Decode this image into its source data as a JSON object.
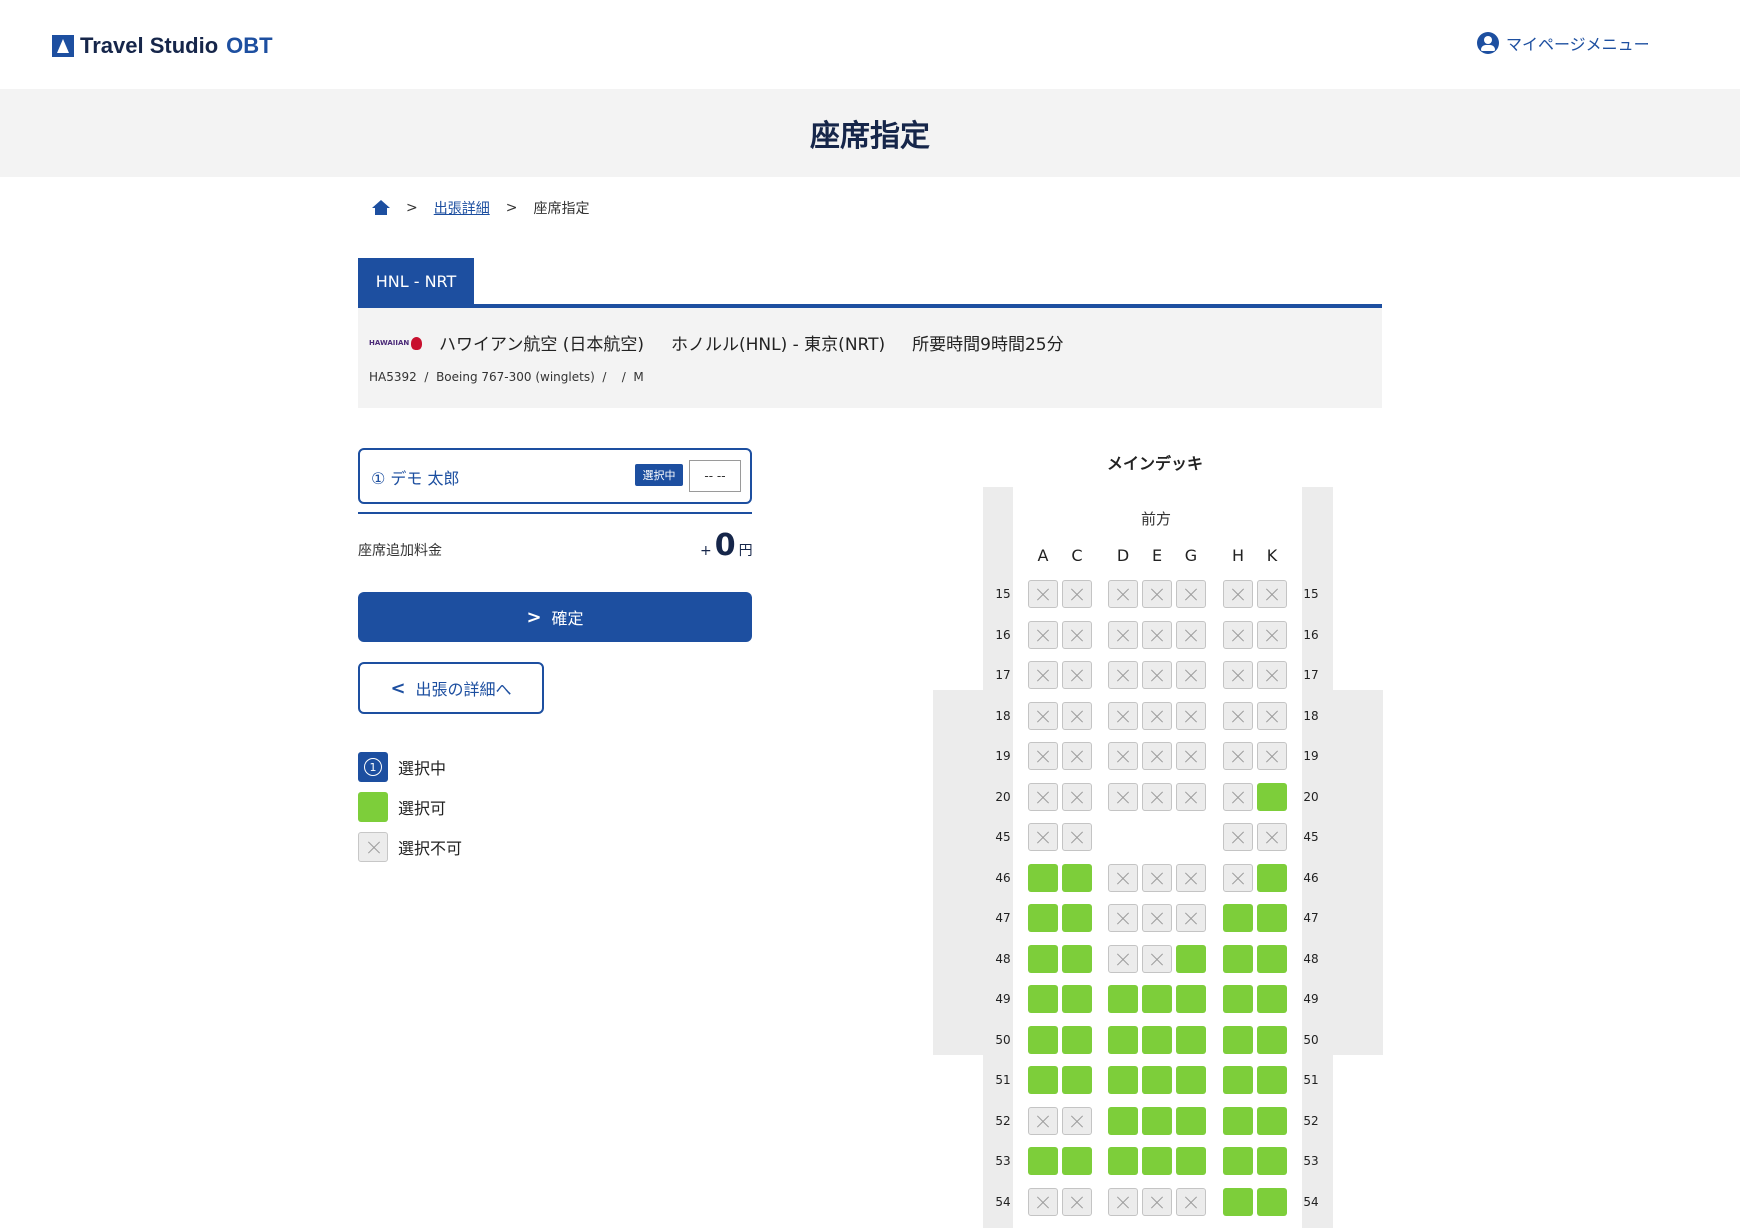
{
  "header": {
    "logo_text": "Travel Studio",
    "logo_suffix": "OBT",
    "mypage_label": "マイページメニュー"
  },
  "page_title": "座席指定",
  "breadcrumb": {
    "sep1": ">",
    "link": "出張詳細",
    "sep2": ">",
    "current": "座席指定"
  },
  "route_tab": "HNL - NRT",
  "flight": {
    "airline_logo_text": "HAWAIIAN",
    "main_line": "ハワイアン航空 (日本航空)     ホノルル(HNL) - 東京(NRT)     所要時間9時間25分",
    "sub_line": "HA5392  /  Boeing 767-300 (winglets)  /    /  M"
  },
  "passenger": {
    "name": "① デモ 太郎",
    "badge": "選択中",
    "seat_value": "-- --"
  },
  "fee": {
    "label": "座席追加料金",
    "plus": "+",
    "amount": "0",
    "unit": "円"
  },
  "buttons": {
    "confirm_icon": ">",
    "confirm": "確定",
    "back_icon": "<",
    "back": "出張の詳細へ"
  },
  "legend": {
    "selected_num": "1",
    "selected": "選択中",
    "available": "選択可",
    "unavailable": "選択不可"
  },
  "seatmap": {
    "deck": "メインデッキ",
    "front": "前方",
    "columns": [
      "A",
      "C",
      "D",
      "E",
      "G",
      "H",
      "K"
    ],
    "rows": [
      {
        "num": "15",
        "seats": [
          "x",
          "x",
          "x",
          "x",
          "x",
          "x",
          "x"
        ]
      },
      {
        "num": "16",
        "seats": [
          "x",
          "x",
          "x",
          "x",
          "x",
          "x",
          "x"
        ]
      },
      {
        "num": "17",
        "seats": [
          "x",
          "x",
          "x",
          "x",
          "x",
          "x",
          "x"
        ]
      },
      {
        "num": "18",
        "seats": [
          "x",
          "x",
          "x",
          "x",
          "x",
          "x",
          "x"
        ]
      },
      {
        "num": "19",
        "seats": [
          "x",
          "x",
          "x",
          "x",
          "x",
          "x",
          "x"
        ]
      },
      {
        "num": "20",
        "seats": [
          "x",
          "x",
          "x",
          "x",
          "x",
          "x",
          "a"
        ]
      },
      {
        "num": "45",
        "seats": [
          "x",
          "x",
          "-",
          "-",
          "-",
          "x",
          "x"
        ]
      },
      {
        "num": "46",
        "seats": [
          "a",
          "a",
          "x",
          "x",
          "x",
          "x",
          "a"
        ]
      },
      {
        "num": "47",
        "seats": [
          "a",
          "a",
          "x",
          "x",
          "x",
          "a",
          "a"
        ]
      },
      {
        "num": "48",
        "seats": [
          "a",
          "a",
          "x",
          "x",
          "a",
          "a",
          "a"
        ]
      },
      {
        "num": "49",
        "seats": [
          "a",
          "a",
          "a",
          "a",
          "a",
          "a",
          "a"
        ]
      },
      {
        "num": "50",
        "seats": [
          "a",
          "a",
          "a",
          "a",
          "a",
          "a",
          "a"
        ]
      },
      {
        "num": "51",
        "seats": [
          "a",
          "a",
          "a",
          "a",
          "a",
          "a",
          "a"
        ]
      },
      {
        "num": "52",
        "seats": [
          "x",
          "x",
          "a",
          "a",
          "a",
          "a",
          "a"
        ]
      },
      {
        "num": "53",
        "seats": [
          "a",
          "a",
          "a",
          "a",
          "a",
          "a",
          "a"
        ]
      },
      {
        "num": "54",
        "seats": [
          "x",
          "x",
          "x",
          "x",
          "x",
          "a",
          "a"
        ]
      }
    ]
  },
  "colors": {
    "brand": "#1d4fa0",
    "available": "#7dce3a",
    "unavailable": "#ececec"
  }
}
